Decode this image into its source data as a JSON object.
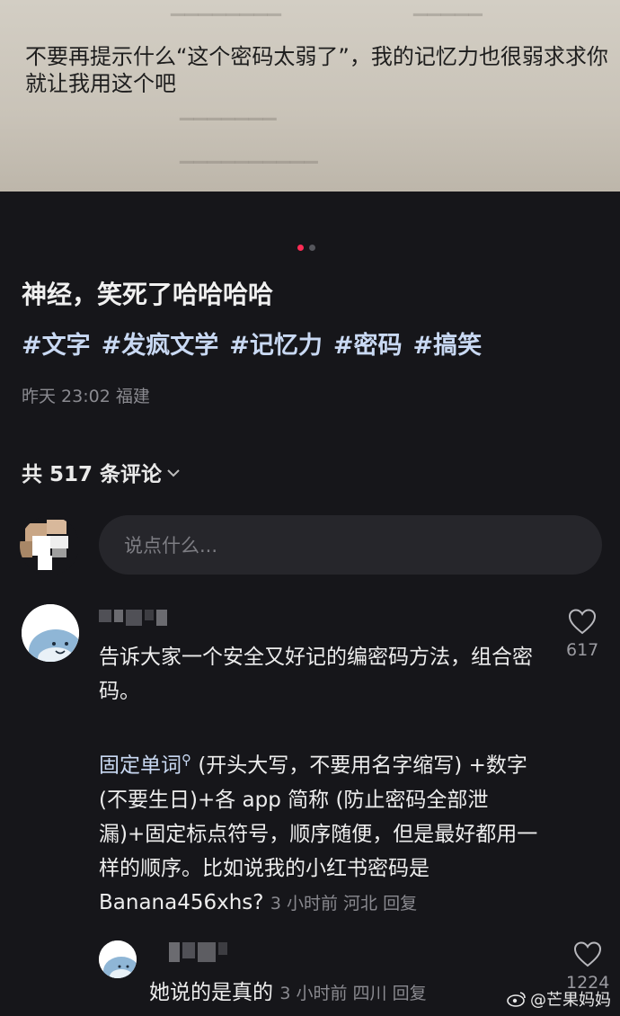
{
  "photo": {
    "caption": "不要再提示什么“这个密码太弱了”，我的记忆力也很弱求求你就让我用这个吧"
  },
  "post": {
    "title": "神经，笑死了哈哈哈哈",
    "tags": [
      "#文字",
      "#发疯文学",
      "#记忆力",
      "#密码",
      "#搞笑"
    ],
    "time": "昨天 23:02",
    "location": "福建"
  },
  "comments_header": {
    "label": "共 517 条评论"
  },
  "input": {
    "placeholder": "说点什么..."
  },
  "comment1": {
    "intro": "告诉大家一个安全又好记的编密码方法，组合密码。",
    "link": "固定单词",
    "body": "(开头大写，不要用名字缩写) +数字 (不要生日)+各 app 简称 (防止密码全部泄漏)+固定标点符号，顺序随便，但是最好都用一样的顺序。比如说我的小红书密码是Banana456xhs?",
    "time": "3 小时前",
    "location": "河北",
    "reply_label": "回复",
    "likes": "617"
  },
  "comment2": {
    "text": "她说的是真的",
    "time": "3 小时前",
    "location": "四川",
    "reply_label": "回复",
    "likes": "1224"
  },
  "watermark": {
    "text": "@芒果妈妈"
  },
  "colors": {
    "accent": "#fe2c55",
    "tag": "#c9d9f3",
    "background": "#16161a"
  }
}
